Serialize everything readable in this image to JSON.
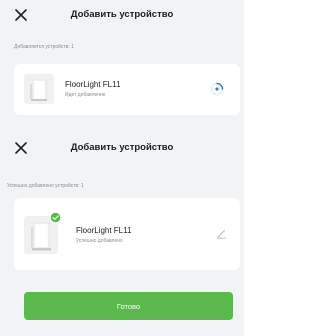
{
  "adding_screen": {
    "title": "Добавить устройство",
    "status": "Добавляется устройств: 1",
    "device": {
      "name": "FloorLight FL11",
      "state": "Идет добавление",
      "status_icon": "loading-spinner-icon"
    }
  },
  "done_screen": {
    "title": "Добавить устройство",
    "status": "Успешно добавлено устройств: 1",
    "device": {
      "name": "FloorLight FL11",
      "state": "Успешно добавлено",
      "badge_icon": "check-badge-icon",
      "action_icon": "edit-icon"
    },
    "done_button": "Готово"
  },
  "colors": {
    "background": "#f2f3f4",
    "card": "#ffffff",
    "accent_green": "#5ab84c",
    "spinner_blue": "#2b7de9"
  }
}
